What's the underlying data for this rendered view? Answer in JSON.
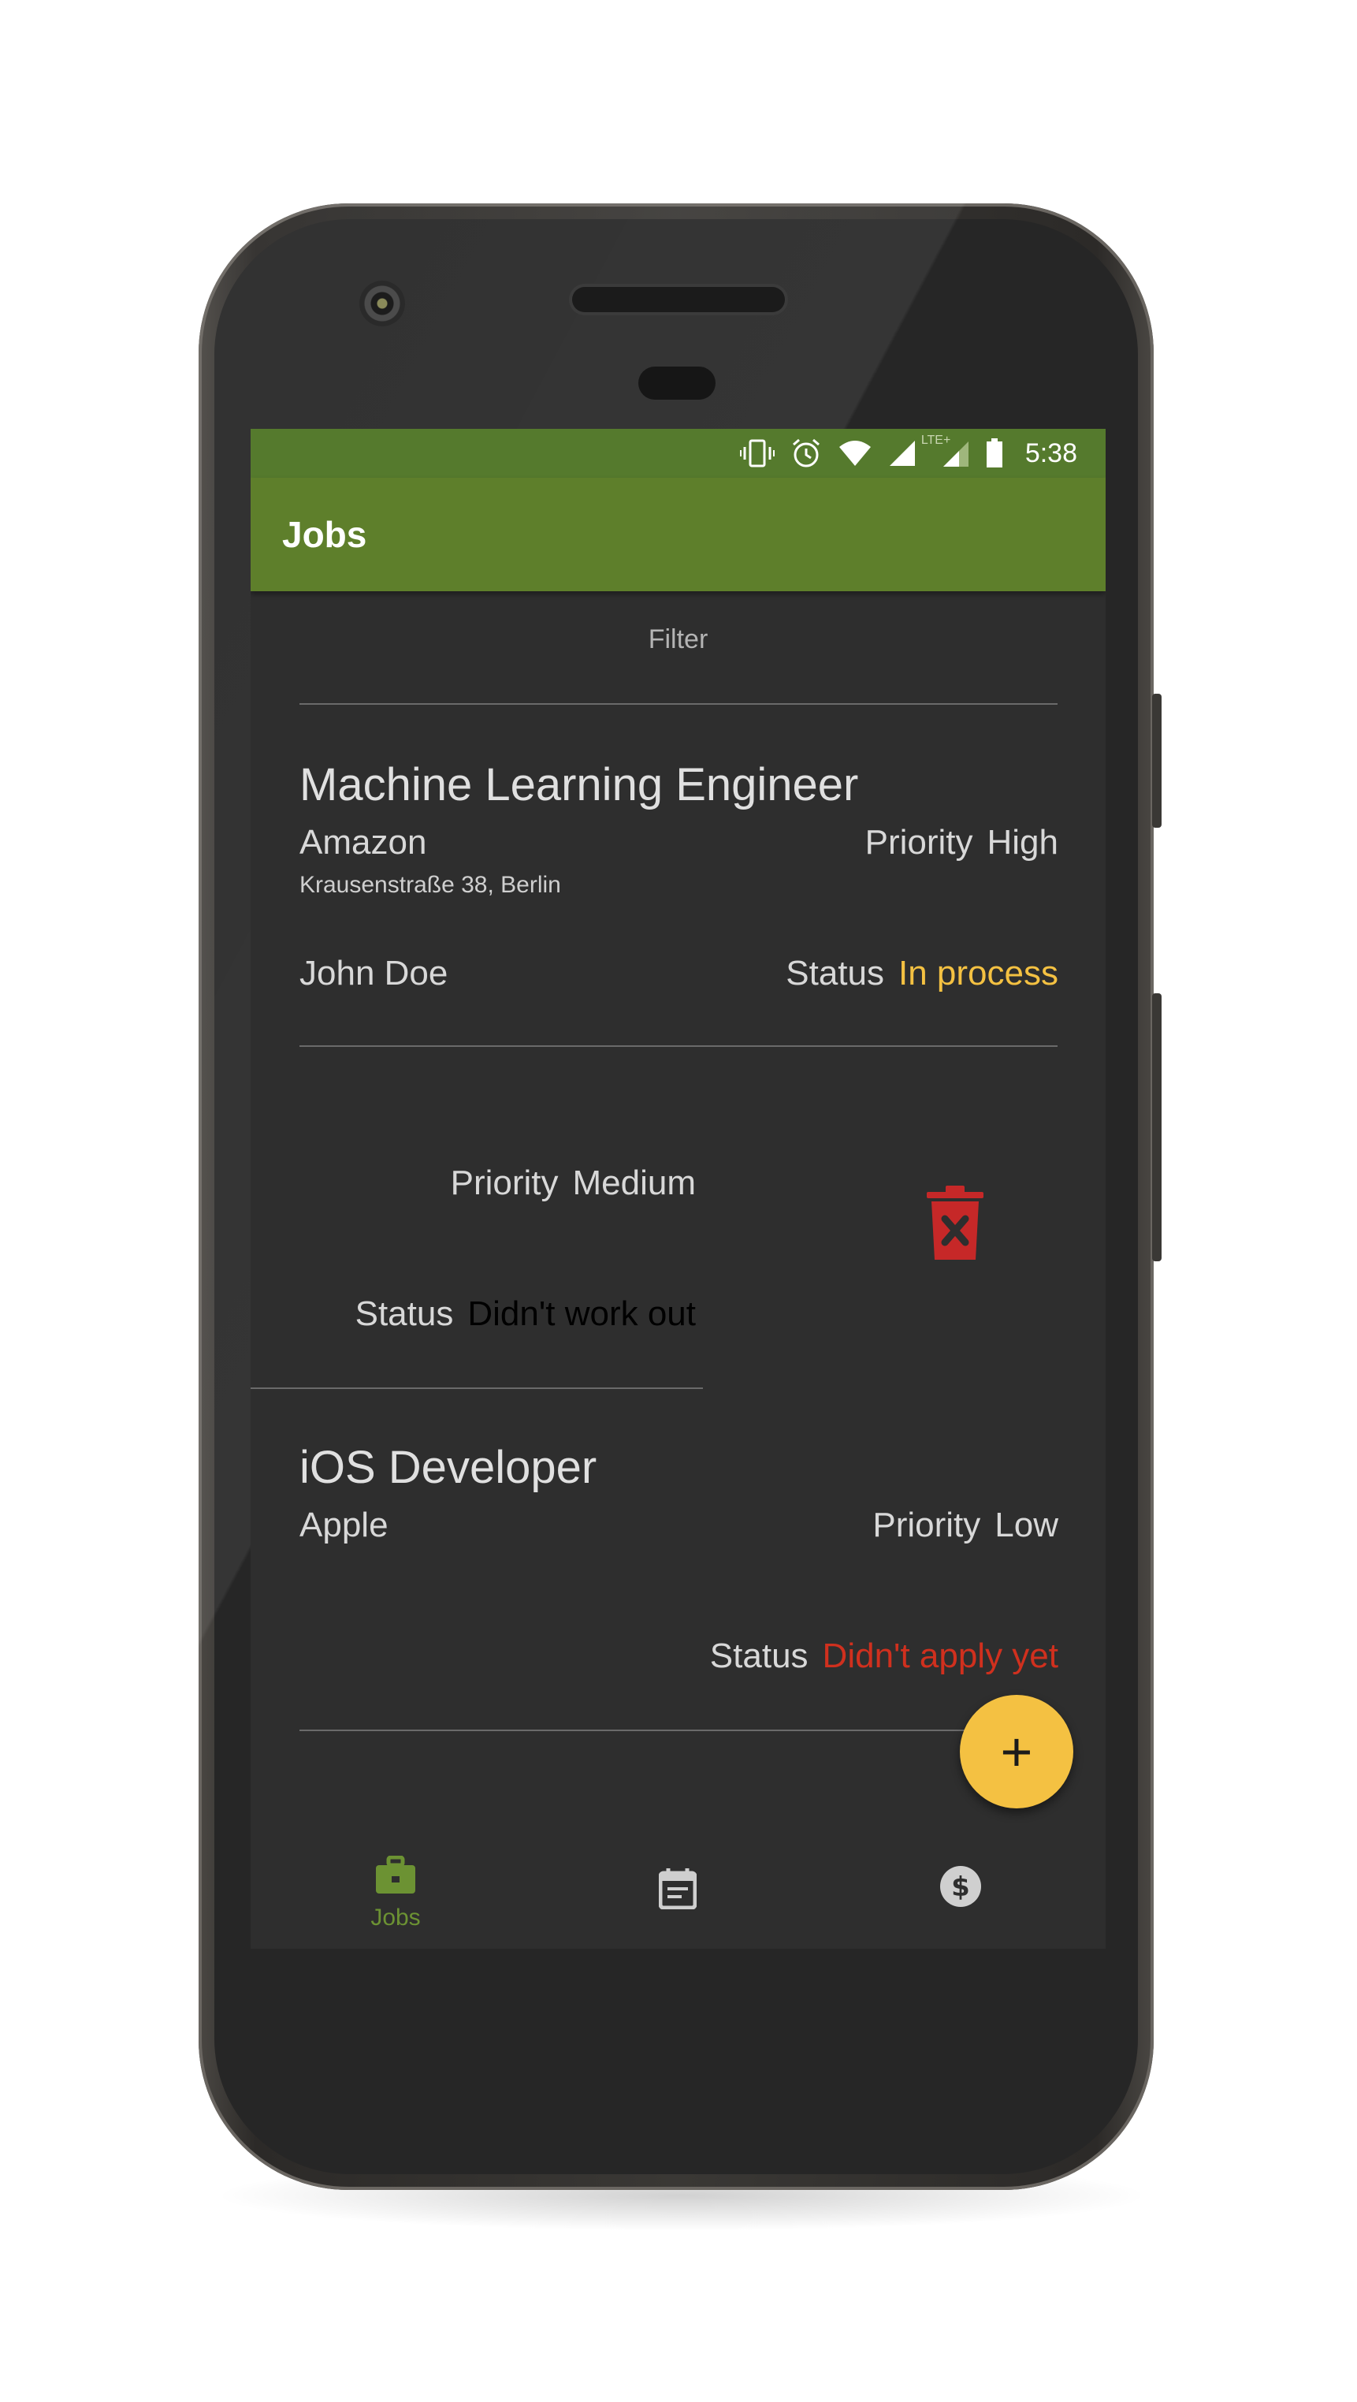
{
  "colors": {
    "status_bar": "#557a2d",
    "app_bar": "#5e7f2b",
    "background": "#2e2e2e",
    "status_in_process": "#f4c142",
    "status_didnt_work_out": "#000000",
    "status_didnt_apply_yet": "#d0301e",
    "delete": "#c62828",
    "fab": "#f4c142",
    "nav_active": "#6c9233",
    "nav_inactive": "#cfcfcf"
  },
  "status_bar": {
    "icons": [
      "vibrate-icon",
      "alarm-icon",
      "wifi-icon",
      "signal-icon",
      "lte-signal-icon",
      "battery-icon"
    ],
    "lte_label": "LTE+",
    "time": "5:38"
  },
  "app_bar": {
    "title": "Jobs"
  },
  "filter": {
    "label": "Filter"
  },
  "jobs": [
    {
      "title": "Machine Learning Engineer",
      "company": "Amazon",
      "address": "Krausenstraße 38, Berlin",
      "contact": "John Doe",
      "priority_label": "Priority",
      "priority": "High",
      "status_label": "Status",
      "status": "In process"
    },
    {
      "priority_label": "Priority",
      "priority": "Medium",
      "status_label": "Status",
      "status": "Didn't work out",
      "swiped": true,
      "action_icon": "delete-icon"
    },
    {
      "title": "iOS Developer",
      "company": "Apple",
      "priority_label": "Priority",
      "priority": "Low",
      "status_label": "Status",
      "status": "Didn't apply yet"
    }
  ],
  "fab": {
    "label": "+",
    "icon": "add-icon"
  },
  "bottom_nav": {
    "items": [
      {
        "label": "Jobs",
        "icon": "briefcase-icon",
        "active": true
      },
      {
        "label": "",
        "icon": "calendar-icon",
        "active": false
      },
      {
        "label": "",
        "icon": "dollar-icon",
        "active": false
      }
    ]
  }
}
